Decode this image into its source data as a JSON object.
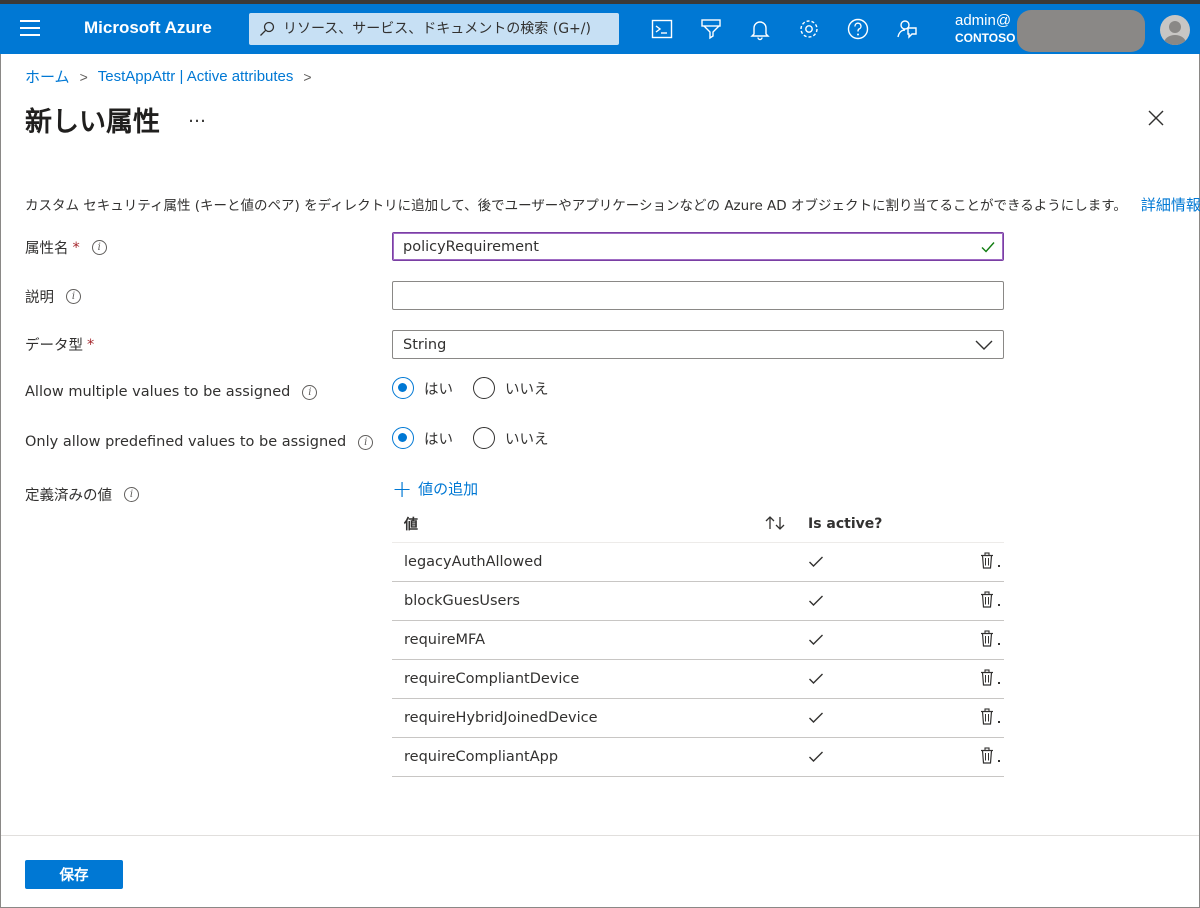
{
  "topbar": {
    "brand": "Microsoft Azure",
    "search_placeholder": "リソース、サービス、ドキュメントの検索 (G+/)",
    "account_name": "admin@",
    "account_tenant": "CONTOSO",
    "icons": [
      "cloud-shell-icon",
      "directory-filter-icon",
      "notifications-icon",
      "settings-icon",
      "help-icon",
      "feedback-icon"
    ]
  },
  "breadcrumb": {
    "home": "ホーム",
    "parent": "TestAppAttr | Active attributes"
  },
  "page": {
    "title": "新しい属性",
    "more": "…",
    "description": "カスタム セキュリティ属性 (キーと値のペア) をディレクトリに追加して、後でユーザーやアプリケーションなどの Azure AD オブジェクトに割り当てることができるようにします。",
    "learn_more": "詳細情報"
  },
  "form": {
    "attribute_name_label": "属性名",
    "attribute_name_value": "policyRequirement",
    "description_label": "説明",
    "description_value": "",
    "data_type_label": "データ型",
    "data_type_value": "String",
    "allow_multiple_label": "Allow multiple values to be assigned",
    "predefined_only_label": "Only allow predefined values to be assigned",
    "yes": "はい",
    "no": "いいえ",
    "allow_multiple_selected": "yes",
    "predefined_only_selected": "yes",
    "required_mark": "*",
    "predefined_values_label": "定義済みの値",
    "add_value": "値の追加"
  },
  "values_table": {
    "headers": {
      "value": "値",
      "is_active": "Is active?"
    },
    "rows": [
      {
        "value": "legacyAuthAllowed",
        "active": true
      },
      {
        "value": "blockGuesUsers",
        "active": true
      },
      {
        "value": "requireMFA",
        "active": true
      },
      {
        "value": "requireCompliantDevice",
        "active": true
      },
      {
        "value": "requireHybridJoinedDevice",
        "active": true
      },
      {
        "value": "requireCompliantApp",
        "active": true
      }
    ]
  },
  "footer": {
    "save": "保存"
  },
  "colors": {
    "accent": "#0078d4",
    "required": "#a4262c",
    "focus_border": "#7a3fa3",
    "valid_check": "#107c10"
  }
}
